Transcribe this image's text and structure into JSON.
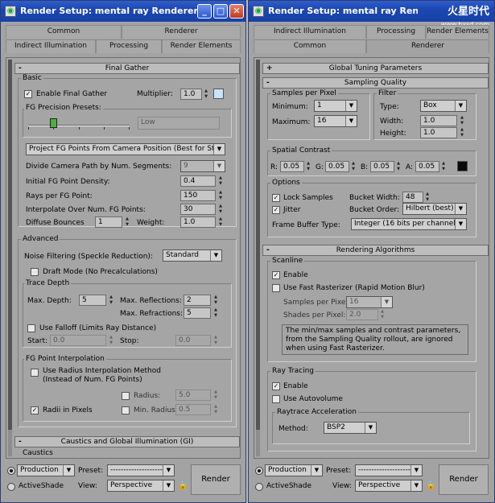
{
  "left": {
    "title": "Render Setup: mental ray Renderer",
    "tabs_row1": [
      "Common",
      "Renderer"
    ],
    "tabs_row2": [
      "Indirect Illumination",
      "Processing",
      "Render Elements"
    ],
    "final_gather": {
      "header": "Final Gather",
      "basic_label": "Basic",
      "enable_label": "Enable Final Gather",
      "multiplier_label": "Multiplier:",
      "multiplier": "1.0",
      "multiplier_color": "#c8e4f8",
      "presets_label": "FG Precision Presets:",
      "preset_value": "Low",
      "projection_mode": "Project FG Points From Camera Position (Best for Stills)",
      "divide_label": "Divide Camera Path by Num. Segments:",
      "divide_value": "9",
      "density_label": "Initial FG Point Density:",
      "density": "0.4",
      "rays_label": "Rays per FG Point:",
      "rays": "150",
      "interp_label": "Interpolate Over Num. FG Points:",
      "interp": "30",
      "bounces_label": "Diffuse Bounces",
      "bounces": "1",
      "weight_label": "Weight:",
      "weight": "1.0"
    },
    "advanced": {
      "label": "Advanced",
      "noise_label": "Noise Filtering (Speckle Reduction):",
      "noise_value": "Standard",
      "draft_label": "Draft Mode (No Precalculations)",
      "trace_label": "Trace Depth",
      "max_depth_label": "Max. Depth:",
      "max_depth": "5",
      "max_refl_label": "Max. Reflections:",
      "max_refl": "2",
      "max_refr_label": "Max. Refractions:",
      "max_refr": "5",
      "falloff_label": "Use Falloff (Limits Ray Distance)",
      "start_label": "Start:",
      "start": "0.0",
      "stop_label": "Stop:",
      "stop": "0.0",
      "interp_group_label": "FG Point Interpolation",
      "radius_interp_label": "Use Radius Interpolation Method",
      "radius_interp_label2": "(Instead of Num. FG Points)",
      "radius_label": "Radius:",
      "radius": "5.0",
      "radii_pixels_label": "Radii in Pixels",
      "min_radius_label": "Min. Radius:",
      "min_radius": "0.5"
    },
    "caustics_header": "Caustics and Global Illumination (GI)",
    "caustics_label": "Caustics"
  },
  "right": {
    "title": "Render Setup: mental ray Renderer",
    "tabs_row1": [
      "Indirect Illumination",
      "Processing",
      "Render Elements"
    ],
    "tabs_row2": [
      "Common",
      "Renderer"
    ],
    "global_tuning_header": "Global Tuning Parameters",
    "sampling_header": "Sampling Quality",
    "samples_label": "Samples per Pixel",
    "minimum_label": "Minimum:",
    "minimum": "1",
    "maximum_label": "Maximum:",
    "maximum": "16",
    "filter_label": "Filter",
    "type_label": "Type:",
    "type_value": "Box",
    "width_label": "Width:",
    "width": "1.0",
    "height_label": "Height:",
    "height": "1.0",
    "contrast_label": "Spatial Contrast",
    "r_label": "R:",
    "r": "0.05",
    "g_label": "G:",
    "g": "0.05",
    "b_label": "B:",
    "b": "0.05",
    "a_label": "A:",
    "a": "0.05",
    "contrast_color": "#0a0a0a",
    "options_label": "Options",
    "lock_label": "Lock Samples",
    "bucket_width_label": "Bucket Width:",
    "bucket_width": "48",
    "jitter_label": "Jitter",
    "bucket_order_label": "Bucket Order:",
    "bucket_order": "Hilbert (best)",
    "fb_label": "Frame Buffer Type:",
    "fb_value": "Integer (16 bits per channel)",
    "algorithms_header": "Rendering Algorithms",
    "scanline_label": "Scanline",
    "scan_enable_label": "Enable",
    "fast_rast_label": "Use Fast Rasterizer (Rapid Motion Blur)",
    "samples_pp_label": "Samples per Pixel:",
    "samples_pp": "16",
    "shades_label": "Shades per Pixel:",
    "shades": "2.0",
    "note": "The min/max samples and contrast parameters, from the Sampling Quality rollout, are ignored when using Fast Rasterizer.",
    "raytracing_label": "Ray Tracing",
    "rt_enable_label": "Enable",
    "autovolume_label": "Use Autovolume",
    "accel_label": "Raytrace Acceleration",
    "method_label": "Method:",
    "method": "BSP2",
    "logo_text": "火星时代",
    "logo_url": "www.hxsd.com"
  },
  "bottom": {
    "production": "Production",
    "activeshade": "ActiveShade",
    "preset_label": "Preset:",
    "preset_value": "--------------------",
    "view_label": "View:",
    "view_value": "Perspective",
    "render": "Render"
  }
}
